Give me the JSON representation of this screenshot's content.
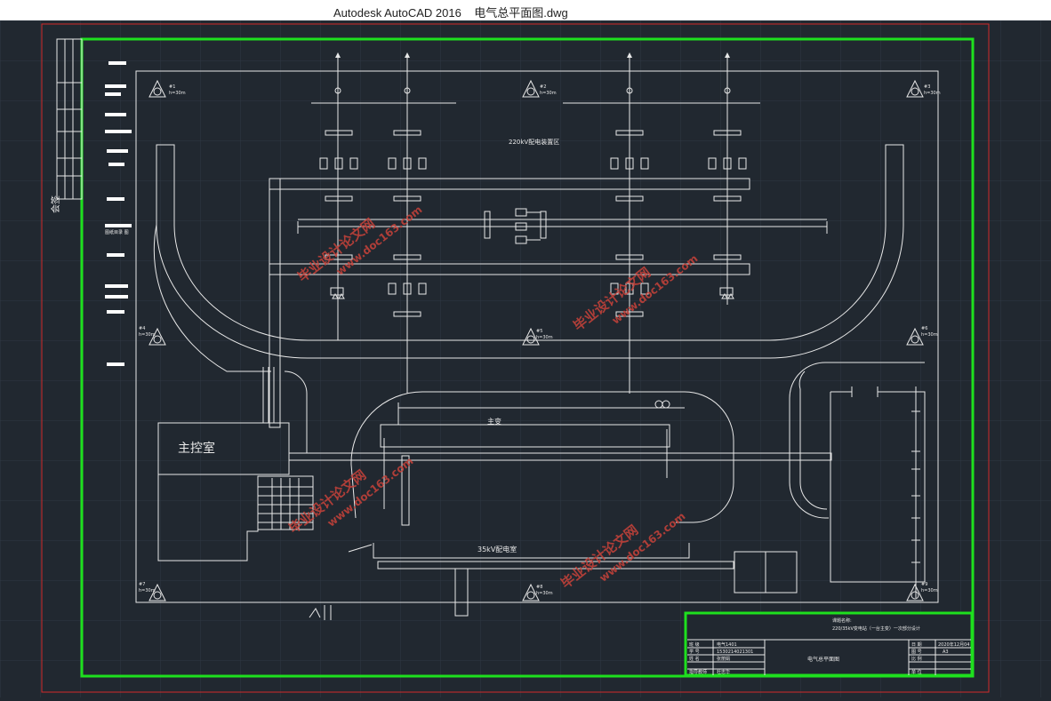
{
  "window": {
    "app_title": "Autodesk AutoCAD 2016",
    "file_name": "电气总平面图.dwg"
  },
  "colors": {
    "background": "#212830",
    "line": "#e8e8e8",
    "frame_red": "#d12a2a",
    "frame_green": "#1ee01e",
    "watermark": "#c8423a"
  },
  "drawing": {
    "labels": {
      "switchyard_220": "220kV配电装置区",
      "main_transformer": "主变",
      "control_room": "主控室",
      "room_35kv": "35kV配电室"
    },
    "lightning_rods": [
      {
        "id": "#1",
        "spec": "h=30m"
      },
      {
        "id": "#2",
        "spec": "h=30m"
      },
      {
        "id": "#3",
        "spec": "h=30m"
      },
      {
        "id": "#4",
        "spec": "h=30m"
      },
      {
        "id": "#5",
        "spec": "h=30m"
      },
      {
        "id": "#6",
        "spec": "h=30m"
      },
      {
        "id": "#7",
        "spec": "h=30m"
      },
      {
        "id": "#8",
        "spec": "h=30m"
      },
      {
        "id": "#9",
        "spec": "h=30m"
      }
    ],
    "watermark_cn": "毕业设计论文网",
    "watermark_url": "www.doc163.com",
    "left_strip_text": "会签",
    "left_strip_note": "图纸目录 图"
  },
  "title_block": {
    "project_label": "课题名称:",
    "project_name": "220/35kV变电站（一台主变）一次部分设计",
    "drawing_name": "电气总平面图",
    "rows": [
      {
        "label": "班 级",
        "value": "电气1401"
      },
      {
        "label": "学 号",
        "value": "1530214021301"
      },
      {
        "label": "姓 名",
        "value": "张丽娟"
      },
      {
        "label": "指导教师",
        "value": "杜忠华"
      }
    ],
    "date_label": "日 期",
    "date_value": "2020年12月04",
    "sheet_label": "图 号",
    "sheet_value": "A3",
    "scale_label": "比 例",
    "unit_label": "单 位"
  }
}
